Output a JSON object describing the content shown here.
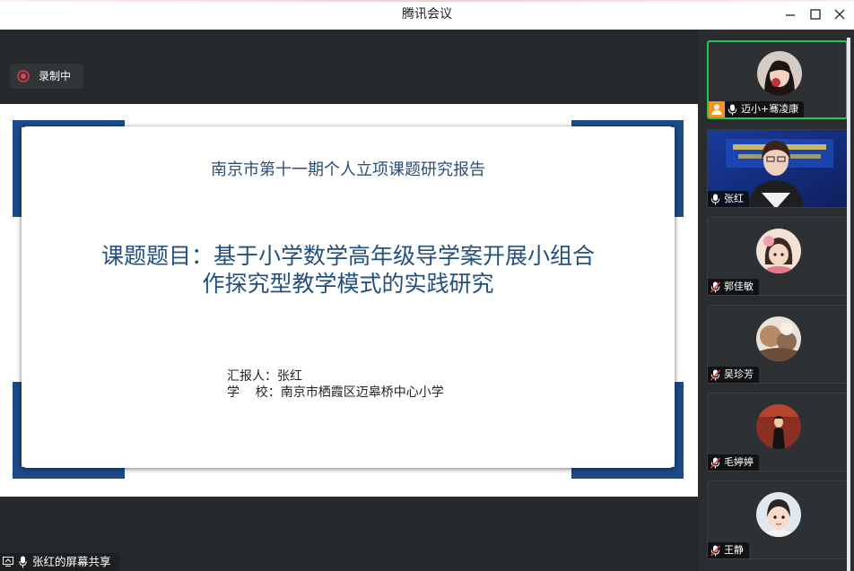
{
  "window": {
    "title": "腾讯会议"
  },
  "recording": {
    "label": "录制中"
  },
  "slide": {
    "top_title": "南京市第十一期个人立项课题研究报告",
    "main_line1": "课题题目：基于小学数学高年级导学案开展小组合",
    "main_line2": "作探究型教学模式的实践研究",
    "reporter": "汇报人：张红",
    "school": "学    校：南京市栖霞区迈皋桥中心小学"
  },
  "share": {
    "label": "张红的屏幕共享"
  },
  "participants": [
    {
      "name": "迈小+骞凌康",
      "muted": false,
      "host": true,
      "active": true
    },
    {
      "name": "张红",
      "muted": false,
      "host": false,
      "active": false
    },
    {
      "name": "郭佳敏",
      "muted": true,
      "host": false,
      "active": false
    },
    {
      "name": "吴珍芳",
      "muted": true,
      "host": false,
      "active": false
    },
    {
      "name": "毛婷婷",
      "muted": true,
      "host": false,
      "active": false
    },
    {
      "name": "王静",
      "muted": true,
      "host": false,
      "active": false
    }
  ],
  "colors": {
    "accent_green": "#27c25a",
    "host_orange": "#f7941d",
    "slide_blue": "#1d4a88",
    "record_red": "#e14545"
  }
}
